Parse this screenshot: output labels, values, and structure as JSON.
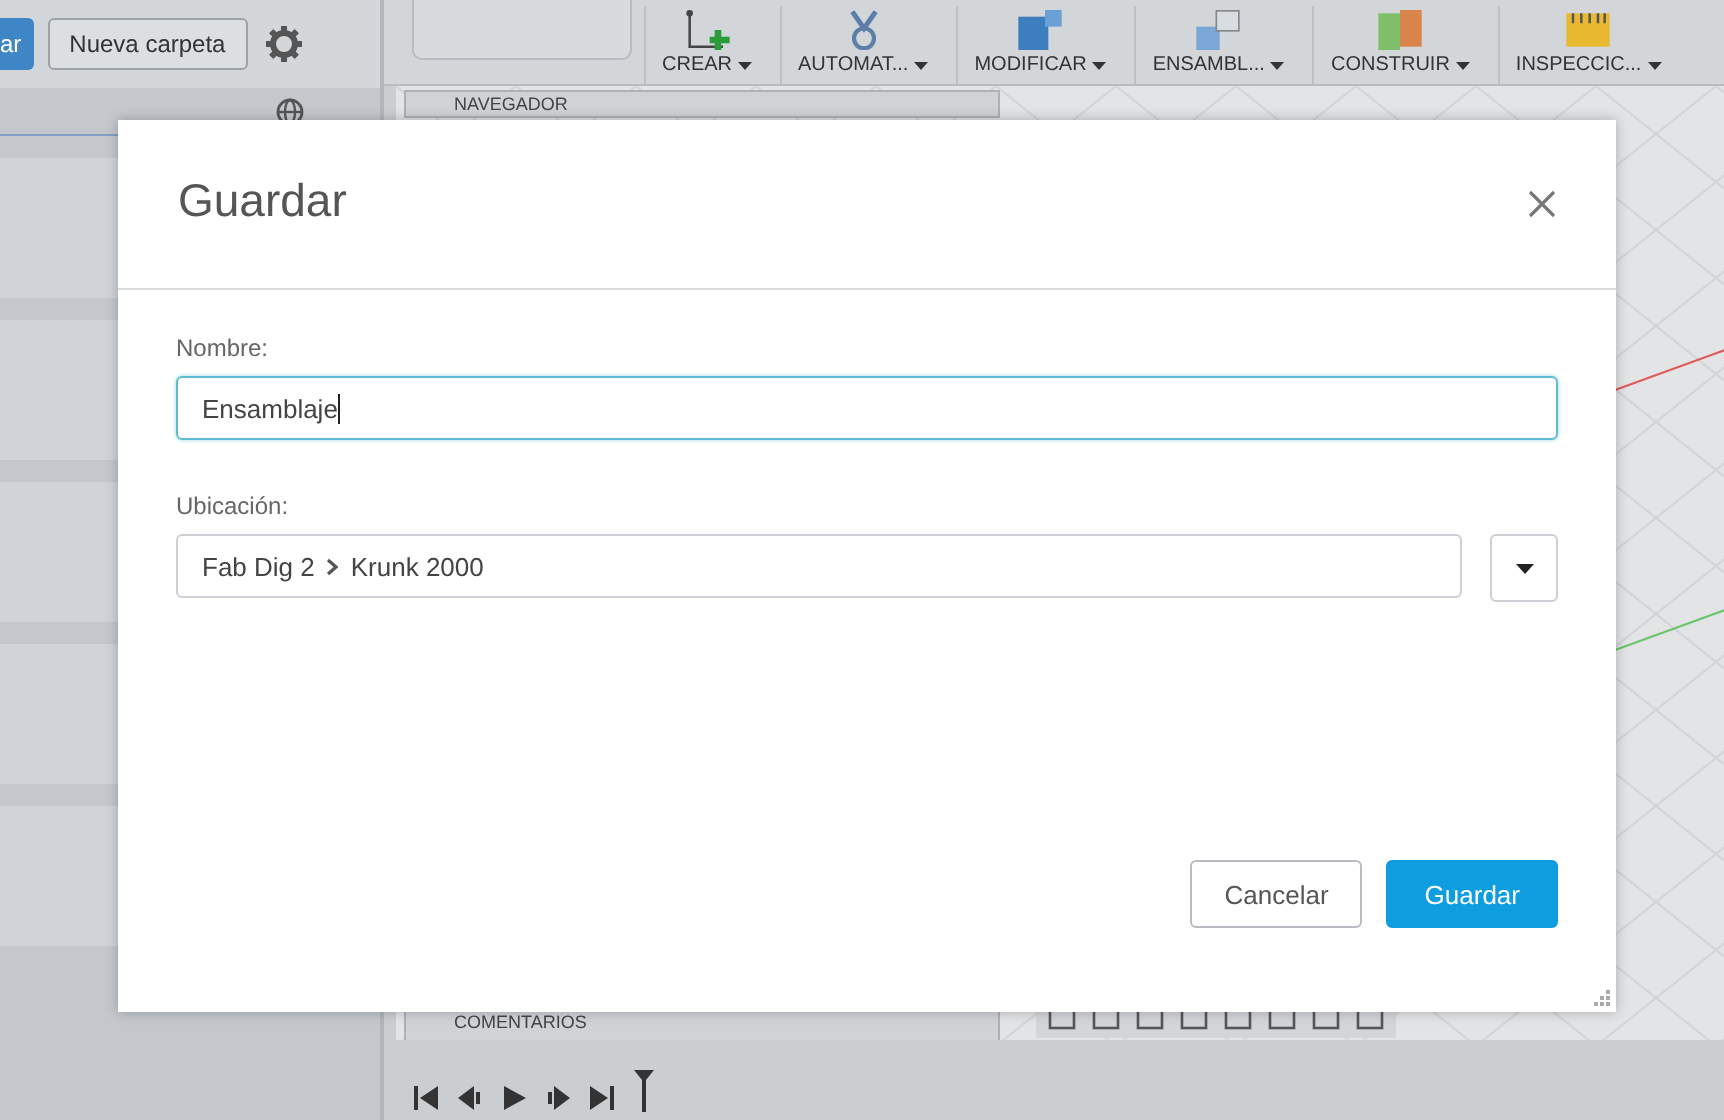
{
  "left_panel": {
    "upload_button": "ar",
    "new_folder_button": "Nueva carpeta"
  },
  "toolbar": {
    "items": [
      {
        "label": "CREAR"
      },
      {
        "label": "AUTOMAT..."
      },
      {
        "label": "MODIFICAR"
      },
      {
        "label": "ENSAMBL..."
      },
      {
        "label": "CONSTRUIR"
      },
      {
        "label": "INSPECCIC..."
      }
    ]
  },
  "browser_panel": {
    "title": "NAVEGADOR"
  },
  "comments_panel": {
    "title": "COMENTARIOS"
  },
  "dialog": {
    "title": "Guardar",
    "name_label": "Nombre:",
    "name_value": "Ensamblaje",
    "location_label": "Ubicación:",
    "location_path": [
      "Fab Dig 2",
      "Krunk 2000"
    ],
    "buttons": [
      {
        "label": "Cancelar",
        "kind": "secondary"
      },
      {
        "label": "Guardar",
        "kind": "primary"
      }
    ]
  }
}
